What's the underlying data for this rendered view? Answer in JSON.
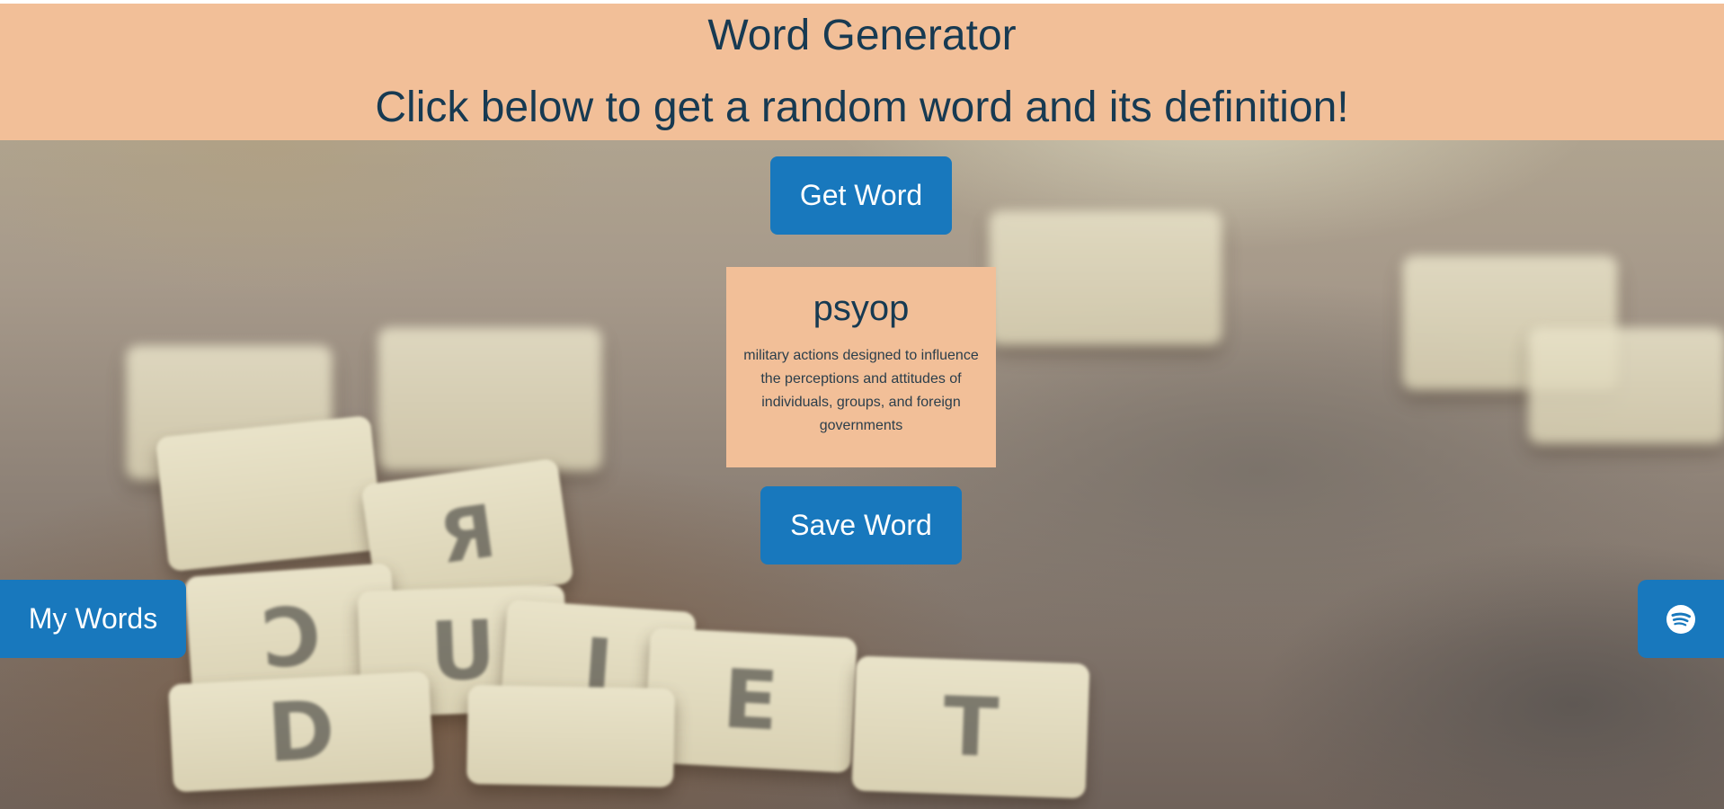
{
  "header": {
    "title": "Word Generator",
    "subtitle": "Click below to get a random word and its definition!"
  },
  "actions": {
    "get_word_label": "Get Word",
    "save_word_label": "Save Word",
    "my_words_label": "My Words",
    "spotify_icon": "spotify-icon"
  },
  "word_card": {
    "word": "psyop",
    "definition": "military actions designed to influence the perceptions and attitudes of individuals, groups, and foreign governments"
  },
  "colors": {
    "header_bg": "#f2bf98",
    "heading_text": "#173a52",
    "button_bg": "#1878bd",
    "button_text": "#ffffff"
  }
}
